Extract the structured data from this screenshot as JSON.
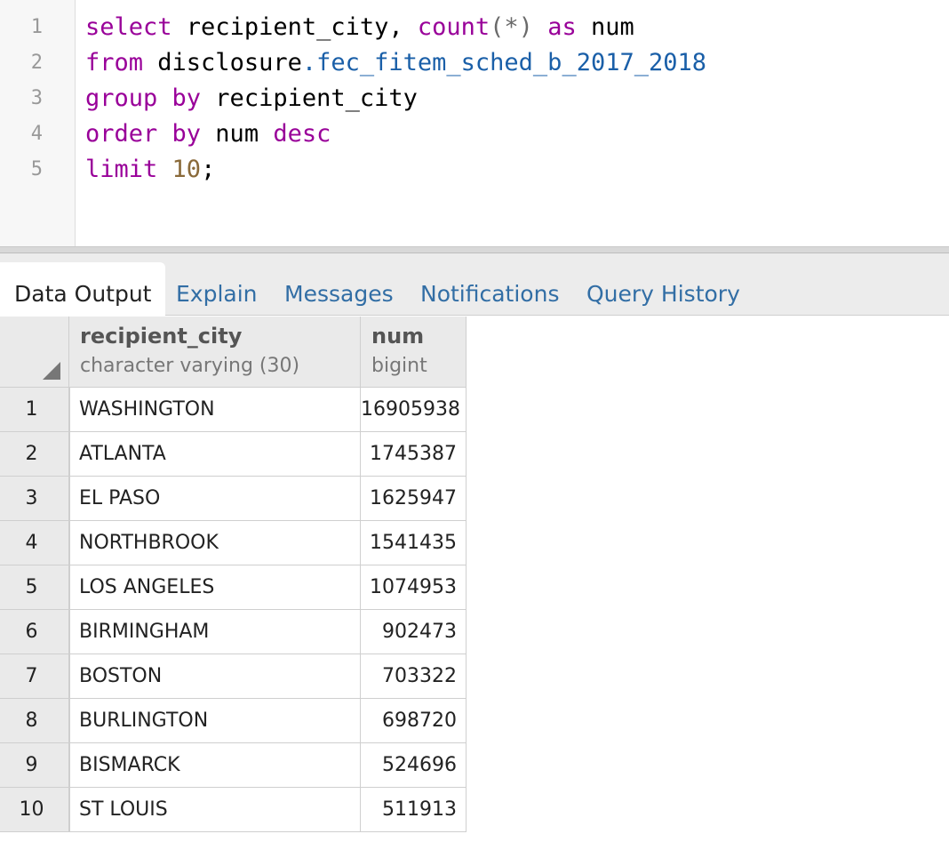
{
  "editor": {
    "line_numbers": [
      "1",
      "2",
      "3",
      "4",
      "5"
    ],
    "lines": [
      {
        "tokens": [
          {
            "t": "select",
            "c": "kw"
          },
          {
            "t": " recipient_city, ",
            "c": ""
          },
          {
            "t": "count",
            "c": "fn"
          },
          {
            "t": "(*)",
            "c": "punct-g"
          },
          {
            "t": " ",
            "c": ""
          },
          {
            "t": "as",
            "c": "kw"
          },
          {
            "t": " num",
            "c": ""
          }
        ]
      },
      {
        "tokens": [
          {
            "t": "from",
            "c": "kw"
          },
          {
            "t": " disclosure",
            "c": ""
          },
          {
            "t": ".fec_fitem_sched_b_2017_2018",
            "c": "ident-b"
          }
        ]
      },
      {
        "tokens": [
          {
            "t": "group by",
            "c": "kw"
          },
          {
            "t": " recipient_city",
            "c": ""
          }
        ]
      },
      {
        "tokens": [
          {
            "t": "order by",
            "c": "kw"
          },
          {
            "t": " num ",
            "c": ""
          },
          {
            "t": "desc",
            "c": "kw"
          }
        ]
      },
      {
        "tokens": [
          {
            "t": "limit",
            "c": "kw"
          },
          {
            "t": " ",
            "c": ""
          },
          {
            "t": "10",
            "c": "num"
          },
          {
            "t": ";",
            "c": ""
          }
        ]
      }
    ]
  },
  "tabs": [
    {
      "label": "Data Output",
      "active": true
    },
    {
      "label": "Explain",
      "active": false
    },
    {
      "label": "Messages",
      "active": false
    },
    {
      "label": "Notifications",
      "active": false
    },
    {
      "label": "Query History",
      "active": false
    }
  ],
  "grid": {
    "columns": [
      {
        "name": "recipient_city",
        "type": "character varying (30)"
      },
      {
        "name": "num",
        "type": "bigint"
      }
    ],
    "rows": [
      {
        "n": "1",
        "city": "WASHINGTON",
        "num": "16905938"
      },
      {
        "n": "2",
        "city": "ATLANTA",
        "num": "1745387"
      },
      {
        "n": "3",
        "city": "EL PASO",
        "num": "1625947"
      },
      {
        "n": "4",
        "city": "NORTHBROOK",
        "num": "1541435"
      },
      {
        "n": "5",
        "city": "LOS ANGELES",
        "num": "1074953"
      },
      {
        "n": "6",
        "city": "BIRMINGHAM",
        "num": "902473"
      },
      {
        "n": "7",
        "city": "BOSTON",
        "num": "703322"
      },
      {
        "n": "8",
        "city": "BURLINGTON",
        "num": "698720"
      },
      {
        "n": "9",
        "city": "BISMARCK",
        "num": "524696"
      },
      {
        "n": "10",
        "city": "ST LOUIS",
        "num": "511913"
      }
    ]
  },
  "colors": {
    "keyword": "#990099",
    "identifier_blue": "#1a5fa8",
    "number": "#8a6a3a",
    "tab_link": "#326ea5"
  }
}
